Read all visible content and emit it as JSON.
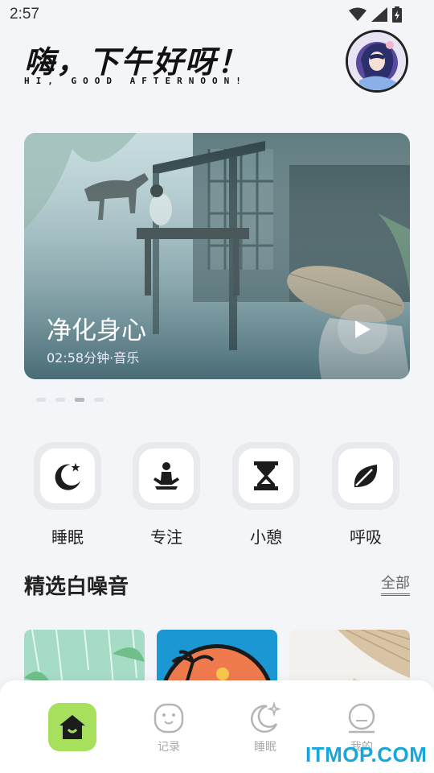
{
  "status_bar": {
    "time": "2:57"
  },
  "greeting": {
    "title": "嗨，下午好呀！",
    "subtitle": "HI, GOOD AFTERNOON!"
  },
  "banner": {
    "title": "净化身心",
    "meta": "02:58分钟·音乐"
  },
  "carousel": {
    "count": 4,
    "active_index": 2
  },
  "categories": [
    {
      "label": "睡眠",
      "icon": "moon-star-icon"
    },
    {
      "label": "专注",
      "icon": "meditation-icon"
    },
    {
      "label": "小憩",
      "icon": "hourglass-icon"
    },
    {
      "label": "呼吸",
      "icon": "leaf-icon"
    }
  ],
  "section": {
    "title": "精选白噪音",
    "view_all": "全部"
  },
  "bottom_nav": [
    {
      "label": "",
      "icon": "home-icon",
      "active": true
    },
    {
      "label": "记录",
      "icon": "face-icon"
    },
    {
      "label": "睡眠",
      "icon": "moon-sparkle-icon"
    },
    {
      "label": "我的",
      "icon": "profile-icon"
    }
  ],
  "watermark": "ITMOP.COM",
  "colors": {
    "accent": "#a6e05c",
    "background": "#f4f5f9",
    "watermark": "#19a6d8"
  }
}
